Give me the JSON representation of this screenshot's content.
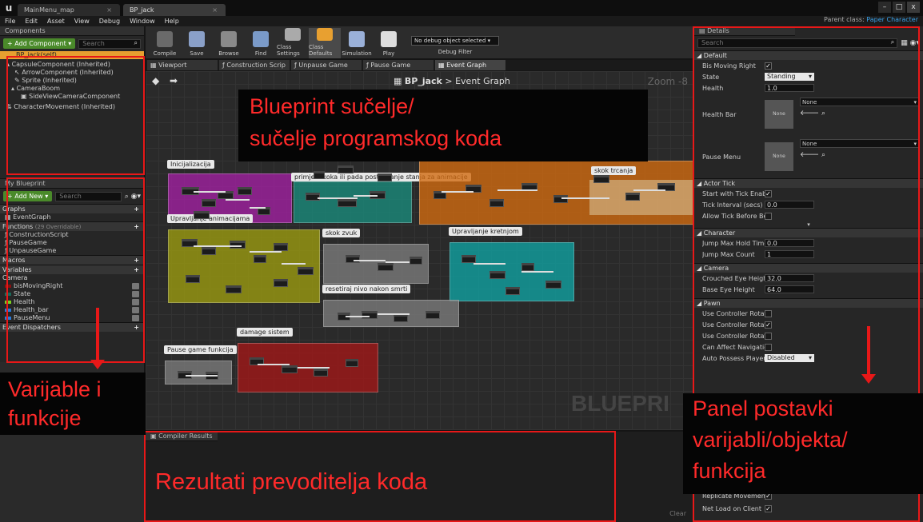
{
  "titlebar": {
    "tabs": [
      {
        "label": "MainMenu_map"
      },
      {
        "label": "BP_jack"
      }
    ],
    "win": {
      "min": "–",
      "max": "□",
      "close": "x"
    }
  },
  "menu": {
    "items": [
      "File",
      "Edit",
      "Asset",
      "View",
      "Debug",
      "Window",
      "Help"
    ],
    "parent_class_label": "Parent class:",
    "parent_class_value": "Paper Character"
  },
  "components": {
    "tab": "Components",
    "add_button": "+ Add Component ▾",
    "search_placeholder": "Search",
    "root": "BP_jack(self)",
    "items": [
      "CapsuleComponent (Inherited)",
      "ArrowComponent (Inherited)",
      "Sprite (Inherited)",
      "CameraBoom",
      "SideViewCameraComponent",
      "CharacterMovement (Inherited)"
    ]
  },
  "myblueprint": {
    "tab": "My Blueprint",
    "add_button": "+ Add New ▾",
    "search_placeholder": "Search",
    "graphs": "Graphs",
    "event_graph": "EventGraph",
    "functions": "Functions",
    "functions_count": "(29 Overridable)",
    "function_items": [
      "ConstructionScript",
      "PauseGame",
      "UnpauseGame"
    ],
    "macros": "Macros",
    "variables": "Variables",
    "camera": "Camera",
    "variable_items": [
      {
        "name": "bisMovingRight",
        "color": "#8a1010"
      },
      {
        "name": "State",
        "color": "#1a6a5a"
      },
      {
        "name": "Health",
        "color": "#7ad020"
      },
      {
        "name": "Health_bar",
        "color": "#2a7ad8"
      },
      {
        "name": "PauseMenu",
        "color": "#2a7ad8"
      }
    ],
    "event_dispatchers": "Event Dispatchers"
  },
  "toolbar": {
    "buttons": [
      {
        "label": "Compile",
        "color": "#6a6a6a"
      },
      {
        "label": "Save",
        "color": "#8aa0c8"
      },
      {
        "label": "Browse",
        "color": "#8a8a8a"
      },
      {
        "label": "Find",
        "color": "#7a9ac8"
      },
      {
        "label": "Class Settings",
        "color": "#aaaaaa"
      },
      {
        "label": "Class Defaults",
        "color": "#e8a030"
      },
      {
        "label": "Simulation",
        "color": "#9ab0d8"
      },
      {
        "label": "Play",
        "color": "#dddddd"
      }
    ],
    "debug_select": "No debug object selected ▾",
    "debug_filter": "Debug Filter"
  },
  "graph_tabs": [
    "Viewport",
    "Construction Scrip",
    "Unpause Game",
    "Pause Game",
    "Event Graph"
  ],
  "breadcrumb": {
    "root": "BP_jack",
    "sep": ">",
    "current": "Event Graph"
  },
  "zoom": "Zoom -8",
  "watermark": "BLUEPRI",
  "comments": [
    {
      "label": "Inicijalizacija",
      "color": "#a020a0"
    },
    {
      "label": "primjer skoka ili pada postavljanje stanja za animacije",
      "color": "#1a8a7a"
    },
    {
      "label": "skok trcanja",
      "color": "#d06a10"
    },
    {
      "label": "Upravljanje animacijama",
      "color": "#9a9a10"
    },
    {
      "label": "skok zvuk",
      "color": "#7a7a7a"
    },
    {
      "label": "Upravljanje kretnjom",
      "color": "#10a0a0"
    },
    {
      "label": "resetiraj nivo nakon smrti",
      "color": "#7a7a7a"
    },
    {
      "label": "damage sistem",
      "color": "#a01818"
    },
    {
      "label": "Pause game funkcija",
      "color": "#7a7a7a"
    }
  ],
  "compiler": {
    "tab": "Compiler Results",
    "clear": "Clear"
  },
  "details": {
    "tab": "Details",
    "search_placeholder": "Search",
    "sections": {
      "default": "Default",
      "actor_tick": "Actor Tick",
      "character": "Character",
      "camera": "Camera",
      "pawn": "Pawn"
    },
    "default_rows": {
      "bis_moving_right": "Bis Moving Right",
      "state": "State",
      "state_value": "Standing",
      "health": "Health",
      "health_value": "1.0",
      "health_bar": "Health Bar",
      "health_bar_value": "None",
      "health_bar_thumb": "None",
      "pause_menu": "Pause Menu",
      "pause_menu_value": "None",
      "pause_menu_thumb": "None"
    },
    "tick_rows": {
      "start": "Start with Tick Enabled",
      "interval": "Tick Interval (secs)",
      "interval_value": "0.0",
      "allow": "Allow Tick Before Begin I"
    },
    "character_rows": {
      "jump_hold": "Jump Max Hold Time",
      "jump_hold_value": "0.0",
      "jump_count": "Jump Max Count",
      "jump_count_value": "1"
    },
    "camera_rows": {
      "crouched": "Crouched Eye Height",
      "crouched_value": "32.0",
      "base": "Base Eye Height",
      "base_value": "64.0"
    },
    "pawn_rows": {
      "rot_p": "Use Controller Rotation P",
      "rot_y": "Use Controller Rotation Y",
      "rot_r": "Use Controller Rotation R",
      "nav": "Can Affect Navigation Ge",
      "auto": "Auto Possess Player",
      "auto_value": "Disabled"
    },
    "bottom_rows": {
      "replicate": "Replicate Movement",
      "net_load": "Net Load on Client"
    }
  },
  "annotations": {
    "blueprint_line1": "Blueprint sučelje/",
    "blueprint_line2": "sučelje programskog koda",
    "vars_line1": "Varijable i",
    "vars_line2": "funkcije",
    "compiler_text": "Rezultati prevoditelja koda",
    "panel_line1": "Panel postavki",
    "panel_line2": "varijabli/objekta/",
    "panel_line3": "funkcija"
  }
}
